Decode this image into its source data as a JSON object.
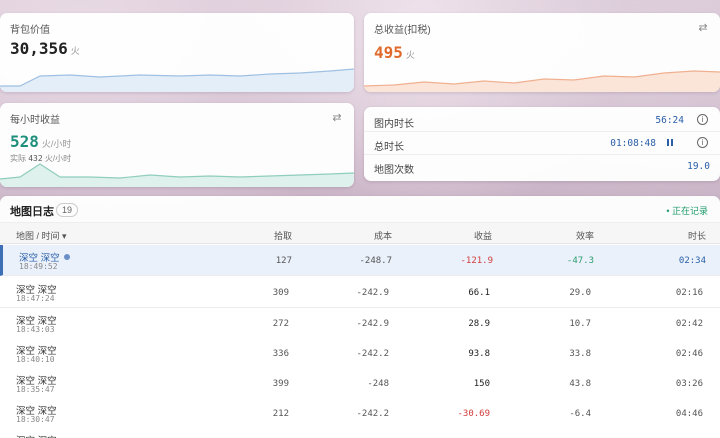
{
  "colors": {
    "accent_orange": "#e06a2c",
    "accent_teal": "#1e8f7c",
    "accent_blue": "#2a5fa8",
    "negative_red": "#d23b3b",
    "positive_green": "#2b9d6e"
  },
  "bag_value": {
    "label": "背包价值",
    "value": "30,356",
    "unit": "火"
  },
  "total_income": {
    "label": "总收益(扣税)",
    "value": "495",
    "unit": "火",
    "icon": "swap-icon"
  },
  "hourly": {
    "label": "每小时收益",
    "value": "528",
    "unit": "火/小时",
    "actual_label": "实际",
    "actual_value": "432",
    "actual_unit": "火/小时",
    "icon": "swap-icon"
  },
  "stats": {
    "in_map": {
      "label": "图内时长",
      "value": "56:24"
    },
    "total": {
      "label": "总时长",
      "value": "01:08:48"
    },
    "maps": {
      "label": "地图次数",
      "value": "19.0"
    }
  },
  "log": {
    "title": "地图日志",
    "count": "19",
    "recording": "• 正在记录",
    "columns": [
      "地图 / 时间 ▾",
      "拾取",
      "成本",
      "收益",
      "效率",
      "时长"
    ],
    "rows": [
      {
        "name": "深空 深空",
        "time": "18:49:52",
        "pickup": "127",
        "cost": "-248.7",
        "income": "-121.9",
        "eff": "-47.3",
        "dur": "02:34"
      },
      {
        "name": "深空 深空",
        "time": "18:47:24",
        "pickup": "309",
        "cost": "-242.9",
        "income": "66.1",
        "eff": "29.0",
        "dur": "02:16"
      },
      {
        "name": "深空 深空",
        "time": "18:43:03",
        "pickup": "272",
        "cost": "-242.9",
        "income": "28.9",
        "eff": "10.7",
        "dur": "02:42"
      },
      {
        "name": "深空 深空",
        "time": "18:40:10",
        "pickup": "336",
        "cost": "-242.2",
        "income": "93.8",
        "eff": "33.8",
        "dur": "02:46"
      },
      {
        "name": "深空 深空",
        "time": "18:35:47",
        "pickup": "399",
        "cost": "-248",
        "income": "150",
        "eff": "43.8",
        "dur": "03:26"
      },
      {
        "name": "深空 深空",
        "time": "18:30:47",
        "pickup": "212",
        "cost": "-242.2",
        "income": "-30.69",
        "eff": "-6.4",
        "dur": "04:46"
      },
      {
        "name": "深空 深空",
        "time": "",
        "pickup": "",
        "cost": "",
        "income": "",
        "eff": "",
        "dur": ""
      }
    ]
  }
}
